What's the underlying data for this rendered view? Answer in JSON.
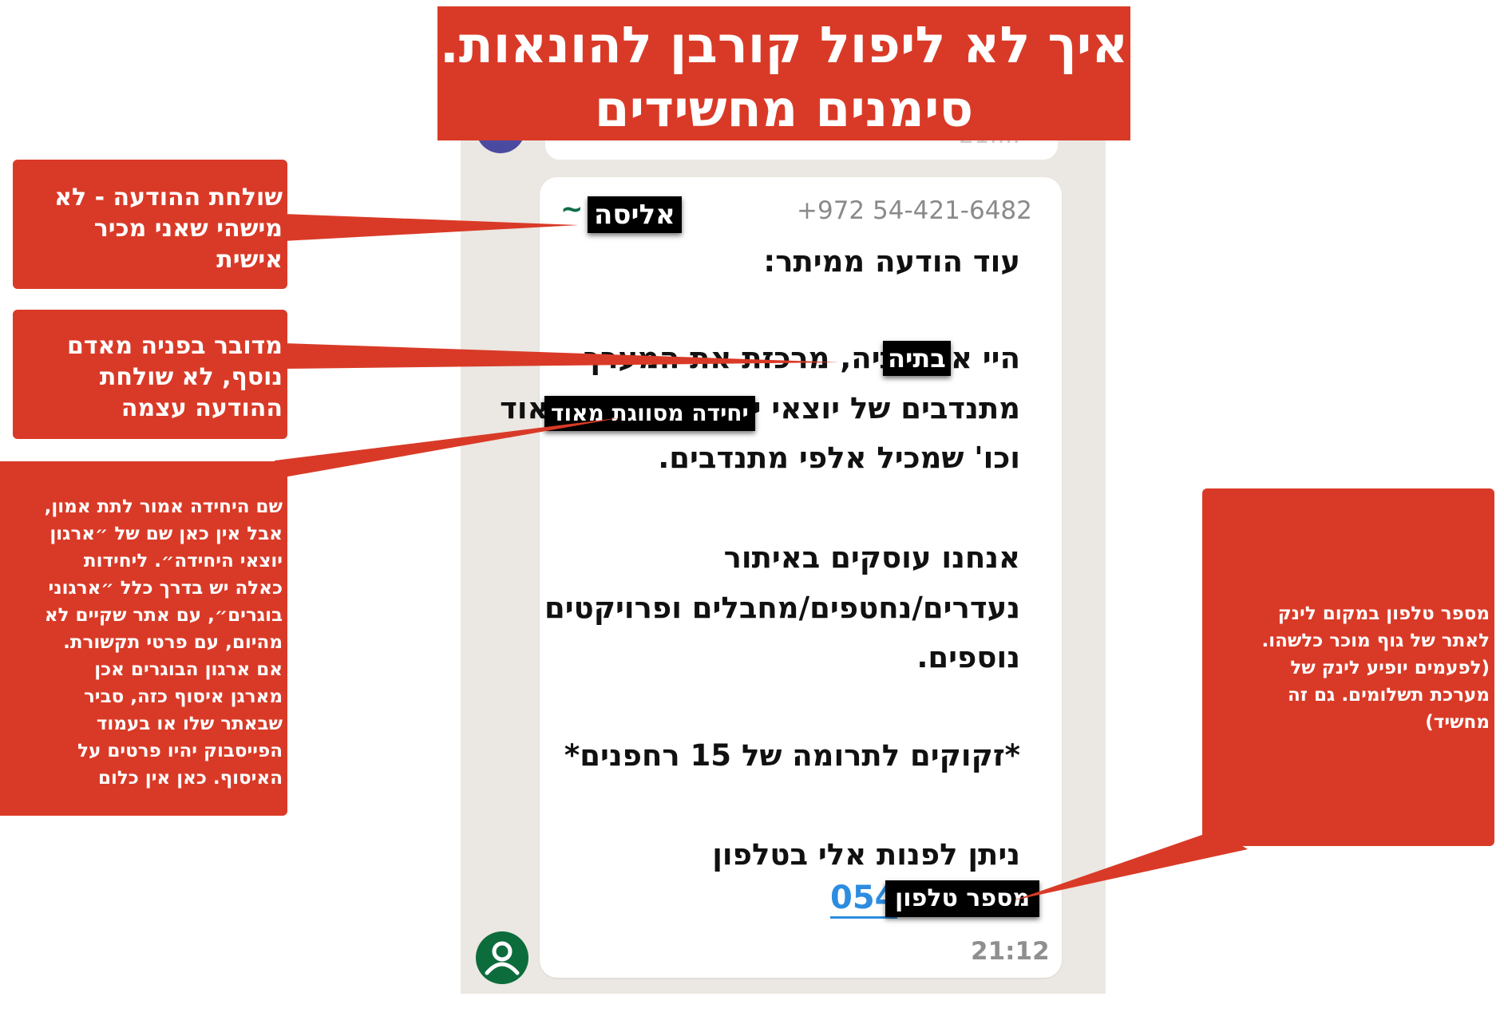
{
  "title": {
    "line1": "איך לא ליפול קורבן להונאות.",
    "line2": "סימנים מחשידים"
  },
  "previous_message": {
    "time_partial": "21:..."
  },
  "message": {
    "sender_phone": "+972 54-421-6482",
    "sender_tilde": "~",
    "sender_name_highlight": "אליסה",
    "lines": [
      "עוד הודעה ממיתר:",
      "היי אני בתיה, מרכזת את המערך",
      "מתנדבים של יוצאי יחידה מסווגת מאוד",
      "וכו' שמכיל אלפי מתנדבים.",
      "אנחנו עוסקים באיתור",
      "נעדרים/נחטפים/מחבלים ופרויקטים",
      "נוספים.",
      "*זקוקים לתרומה של 15 רחפנים*",
      "ניתן לפנות אלי בטלפון"
    ],
    "phone_link_visible": "054",
    "time": "21:12",
    "highlight_name": "בתיה",
    "highlight_unit": "יחידה מסווגת מאוד",
    "highlight_phone": "מספר טלפון"
  },
  "notes": {
    "sender": [
      "שולחת ההודעה - לא",
      "מישהי שאני מכיר",
      "אישית"
    ],
    "on_behalf": [
      "מדובר בפניה מאדם",
      "נוסף, לא שולחת",
      "ההודעה עצמה"
    ],
    "unit_name": [
      "שם היחידה אמור לתת אמון,",
      "אבל אין כאן שם של ״ארגון",
      "יוצאי היחידה״. ליחידות",
      "כאלה יש בדרך כלל ״ארגוני",
      "בוגרים״, עם אתר שקיים לא",
      "מהיום, עם פרטי תקשורת.",
      "אם ארגון הבוגרים אכן",
      "מארגן איסוף כזה, סביר",
      "שבאתר שלו או בעמוד",
      "הפייסבוק יהיו פרטים על",
      "האיסוף. כאן אין כלום"
    ],
    "phone_instead_of_link": [
      "מספר טלפון במקום לינק",
      "לאתר של גוף מוכר כלשהו.",
      "(לפעמים יופיע לינק של",
      "מערכת תשלומים. גם זה",
      "מחשיד)"
    ]
  },
  "colors": {
    "annotation_red": "#d93a27",
    "highlight_black": "#000000",
    "chat_background": "#ebe7e2",
    "bubble_white": "#ffffff",
    "link_blue": "#2c8ce0",
    "avatar_green": "#0c6c3c",
    "avatar_purple": "#4b4aa1"
  },
  "icons": {
    "avatar": "person-icon"
  }
}
